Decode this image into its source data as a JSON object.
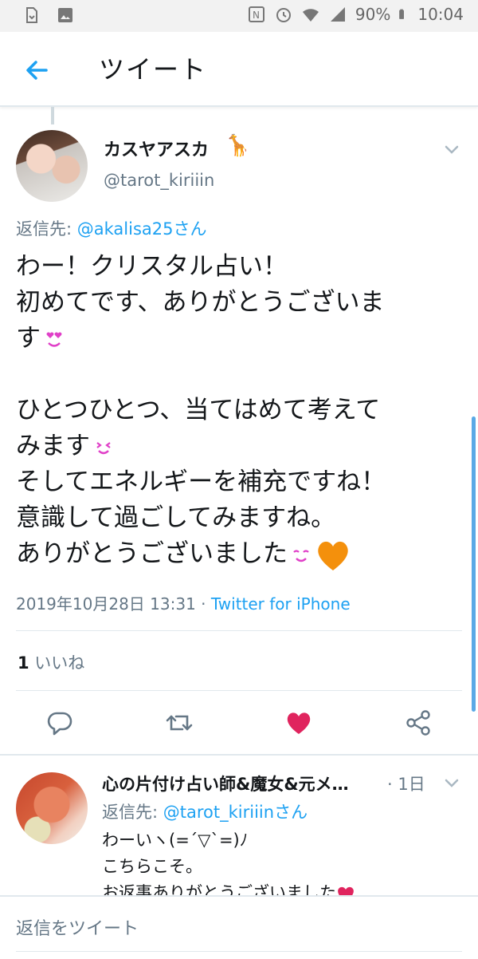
{
  "status_bar": {
    "battery": "90%",
    "time": "10:04"
  },
  "app_bar": {
    "title": "ツイート"
  },
  "tweet": {
    "name": "カスヤアスカ",
    "name_emoji": "🦒",
    "handle": "@tarot_kiriiin",
    "reply_to_prefix": "返信先: ",
    "reply_to_user": "@akalisa25さん",
    "text_lines": {
      "l1": "わー！クリスタル占い！",
      "l2": "初めてです、ありがとうございま",
      "l3": "す",
      "l4": "ひとつひとつ、当てはめて考えて",
      "l5": "みます",
      "l6": "そしてエネルギーを補充ですね！",
      "l7": "意識して過ごしてみますね。",
      "l8": "ありがとうございました"
    },
    "timestamp": "2019年10月28日 13:31",
    "separator": " · ",
    "source": "Twitter for iPhone",
    "like_count": "1",
    "like_label": " いいね"
  },
  "reply": {
    "name": "心の片付け占い師&魔女&元メ…",
    "time": "· 1日",
    "reply_to_prefix": "返信先: ",
    "reply_to_user": "@tarot_kiriiinさん",
    "text": "わーいヽ(=´▽`=)ﾉ\nこちらこそ。\nお返事ありがとうございました"
  },
  "composer": {
    "placeholder": "返信をツイート"
  },
  "colors": {
    "accent": "#1da1f2",
    "like_active": "#e0245e",
    "secondary_text": "#657786",
    "emoji_pink": "#e040c8",
    "heart_orange": "#f4900c"
  },
  "icons": [
    "sim-icon",
    "image-icon",
    "nfc-icon",
    "alarm-icon",
    "wifi-icon",
    "signal-icon",
    "battery-icon",
    "back-arrow-icon",
    "chevron-down-icon",
    "reply-icon",
    "retweet-icon",
    "like-icon",
    "share-icon"
  ]
}
